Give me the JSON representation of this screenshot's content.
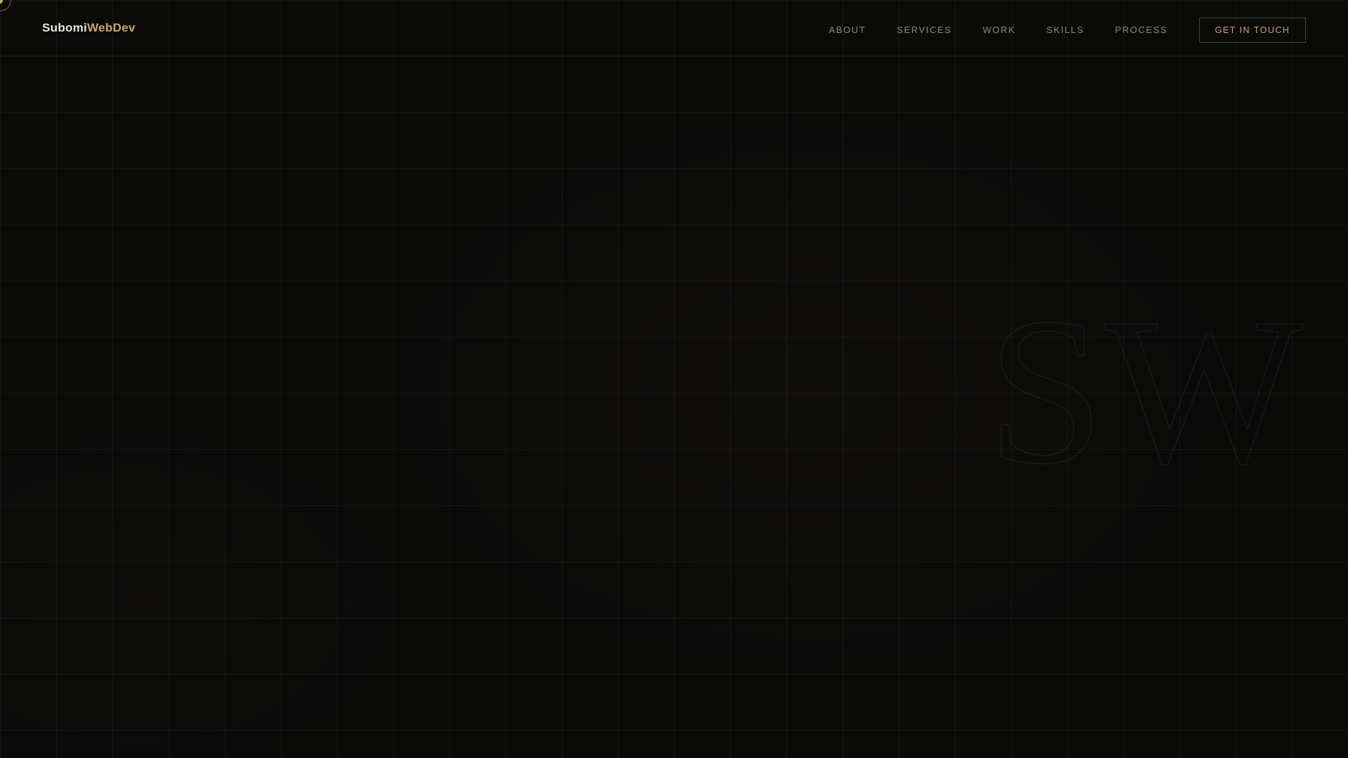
{
  "brand": {
    "name_primary": "Subomi",
    "name_accent": "WebDev",
    "accent_color": "#c8a86e",
    "background_color": "#0a0a09"
  },
  "nav": {
    "items": [
      {
        "label": "ABOUT"
      },
      {
        "label": "SERVICES"
      },
      {
        "label": "WORK"
      },
      {
        "label": "SKILLS"
      },
      {
        "label": "PROCESS"
      }
    ],
    "cta_label": "GET IN TOUCH"
  },
  "hero": {
    "monogram": "SW"
  }
}
